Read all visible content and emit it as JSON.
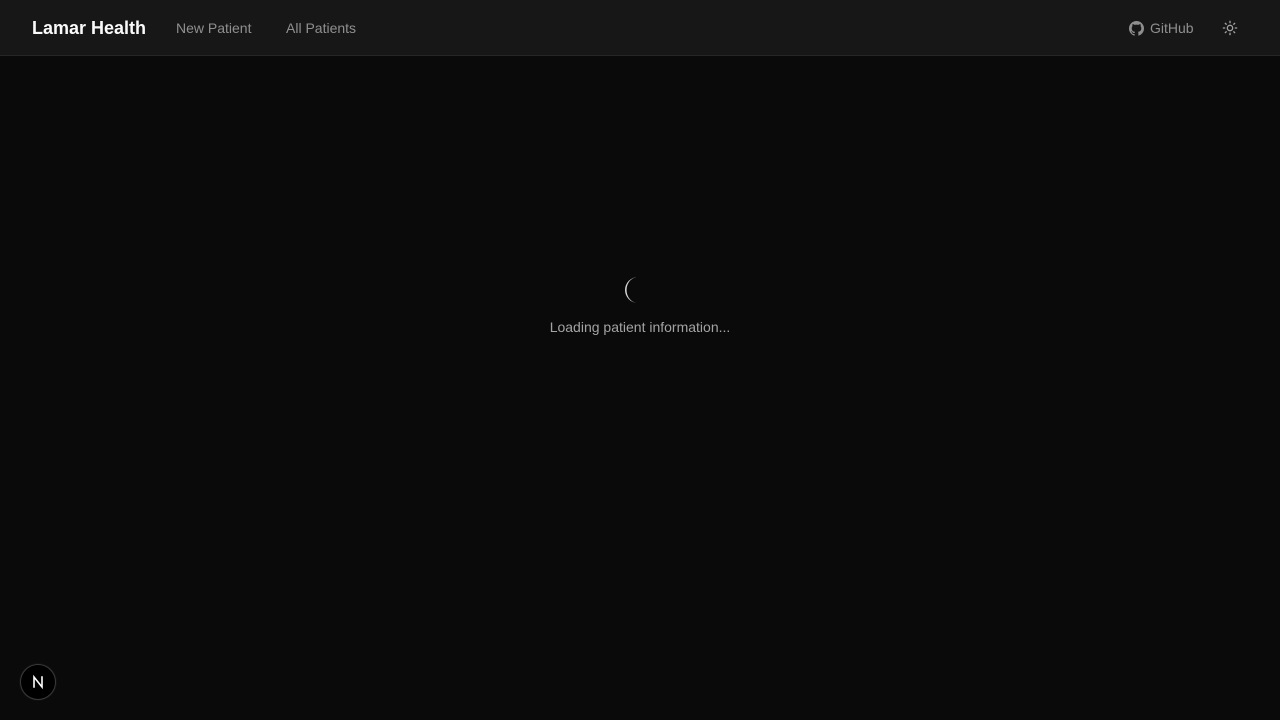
{
  "header": {
    "brand": "Lamar Health",
    "nav": [
      {
        "label": "New Patient"
      },
      {
        "label": "All Patients"
      }
    ],
    "github_label": "GitHub",
    "github_icon": "github-icon",
    "theme_icon": "sun-icon"
  },
  "main": {
    "loading_text": "Loading patient information...",
    "spinner_icon": "spinner-icon"
  },
  "dev_badge": {
    "icon": "nextjs-logo-icon",
    "letter": "N"
  },
  "colors": {
    "background": "#0a0a0a",
    "header_bg": "#171717",
    "text_primary": "#fafafa",
    "text_muted": "#8f8f8f"
  }
}
